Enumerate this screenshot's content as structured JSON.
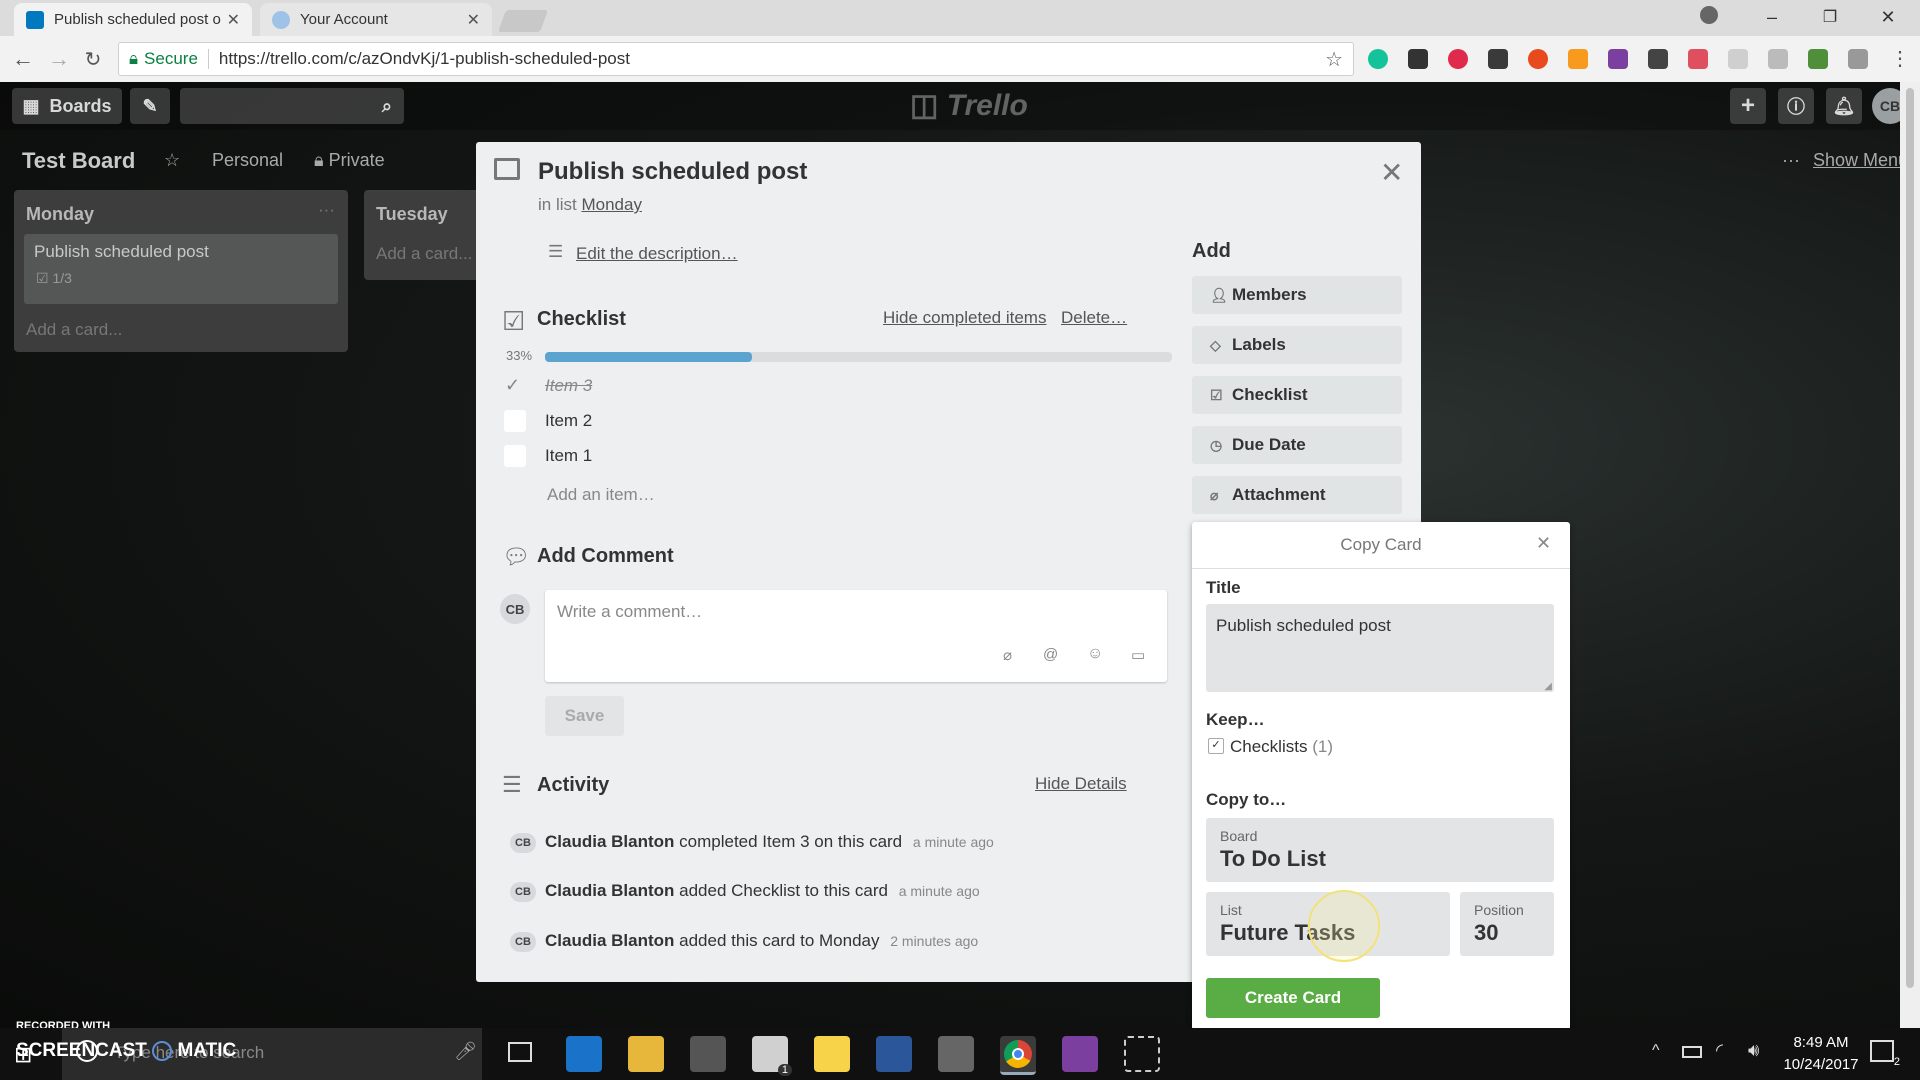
{
  "browser": {
    "tabs": [
      {
        "title": "Publish scheduled post o",
        "active": true
      },
      {
        "title": "Your Account",
        "active": false
      }
    ],
    "secure_label": "Secure",
    "url": "https://trello.com/c/azOndvKj/1-publish-scheduled-post"
  },
  "trello": {
    "boards_label": "Boards",
    "logo": "Trello",
    "board_title": "Test Board",
    "team": "Personal",
    "visibility": "Private",
    "show_menu": "Show Menu",
    "user_initials": "CB",
    "lists": [
      {
        "name": "Monday",
        "card": "Publish scheduled post",
        "badge": "1/3",
        "add": "Add a card..."
      },
      {
        "name": "Tuesday",
        "add": "Add a card..."
      }
    ]
  },
  "card": {
    "title": "Publish scheduled post",
    "in_list_prefix": "in list",
    "list_name": "Monday",
    "edit_description": "Edit the description…",
    "checklist": {
      "title": "Checklist",
      "hide_completed": "Hide completed items",
      "delete": "Delete…",
      "percent_label": "33%",
      "progress": 0.33,
      "items": [
        {
          "text": "Item 3",
          "done": true
        },
        {
          "text": "Item 2",
          "done": false
        },
        {
          "text": "Item 1",
          "done": false
        }
      ],
      "add_item": "Add an item…"
    },
    "comment": {
      "title": "Add Comment",
      "avatar": "CB",
      "placeholder": "Write a comment…",
      "save": "Save"
    },
    "activity": {
      "title": "Activity",
      "hide_details": "Hide Details",
      "entries": [
        {
          "avatar": "CB",
          "user": "Claudia Blanton",
          "action": "completed Item 3 on this card",
          "time": "a minute ago"
        },
        {
          "avatar": "CB",
          "user": "Claudia Blanton",
          "action": "added Checklist to this card",
          "time": "a minute ago"
        },
        {
          "avatar": "CB",
          "user": "Claudia Blanton",
          "action": "added this card to Monday",
          "time": "2 minutes ago"
        }
      ]
    },
    "add_heading": "Add",
    "add_buttons": [
      "Members",
      "Labels",
      "Checklist",
      "Due Date",
      "Attachment"
    ]
  },
  "copy_card": {
    "header": "Copy Card",
    "title_label": "Title",
    "title_value": "Publish scheduled post",
    "keep_label": "Keep…",
    "keep_checklists": "Checklists",
    "keep_count": "(1)",
    "copy_to_label": "Copy to…",
    "board_label": "Board",
    "board_value": "To Do List",
    "list_label": "List",
    "list_value": "Future Tasks",
    "position_label": "Position",
    "position_value": "30",
    "create_button": "Create Card"
  },
  "watermark": {
    "line1": "RECORDED WITH",
    "line2": "SCREENCAST",
    "line3": "MATIC"
  },
  "taskbar": {
    "search_placeholder": "Type here to search",
    "time": "8:49 AM",
    "date": "10/24/2017",
    "notif_count": "2",
    "mail_badge": "1"
  },
  "colors": {
    "progress": "#5ba4cf",
    "create_button": "#5aac44",
    "trello_blue": "#0079bf"
  }
}
